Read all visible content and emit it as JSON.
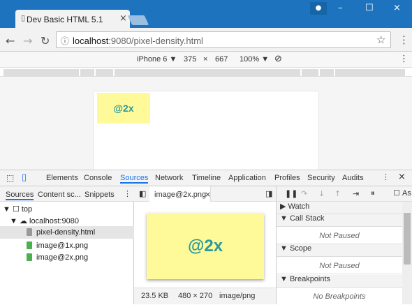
{
  "browser": {
    "tab_title": "Dev Basic HTML 5.1",
    "address_host": "localhost",
    "address_path": ":9080/pixel-density.html"
  },
  "device_toolbar": {
    "device": "iPhone 6",
    "width": "375",
    "height": "667",
    "zoom": "100%"
  },
  "page_images": {
    "small_label": "@2x",
    "large_label": "@2x"
  },
  "devtools": {
    "tabs": [
      "Elements",
      "Console",
      "Sources",
      "Network",
      "Timeline",
      "Application",
      "Profiles",
      "Security",
      "Audits"
    ],
    "active_tab": "Sources",
    "subtabs": [
      "Sources",
      "Content sc...",
      "Snippets"
    ],
    "tree": [
      "top",
      "localhost:9080",
      "pixel-density.html",
      "image@1x.png",
      "image@2x.png"
    ],
    "open_file": "image@2x.png",
    "file_size": "23.5 KB",
    "dimensions": "480 × 270",
    "mime": "image/png",
    "right_sections": [
      "Watch",
      "Call Stack",
      "Scope",
      "Breakpoints"
    ],
    "not_paused": "Not Paused",
    "no_breakpoints": "No Breakpoints",
    "checkbox_label": "As"
  },
  "colors": {
    "title_blue": "#1e73be",
    "image_yellow": "#fffa99",
    "image_text": "#2a9a9a",
    "accent": "#1a73e8"
  },
  "icons": [
    "user-icon",
    "minimize-icon",
    "maximize-icon",
    "close-icon",
    "back-icon",
    "forward-icon",
    "reload-icon",
    "info-icon",
    "star-icon",
    "menu-icon",
    "inspect-icon",
    "device-icon",
    "pause-icon",
    "step-icon"
  ]
}
